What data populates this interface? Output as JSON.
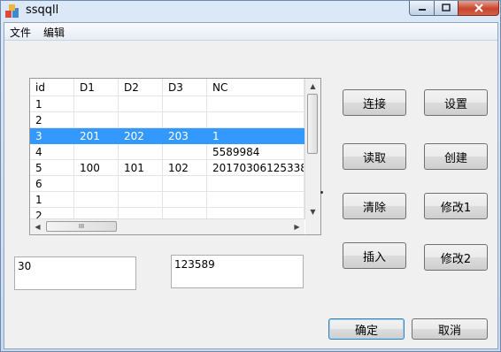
{
  "window": {
    "title": "ssqqll"
  },
  "menu": [
    "文件",
    "编辑"
  ],
  "grid": {
    "columns": [
      "id",
      "D1",
      "D2",
      "D3",
      "NC"
    ],
    "rows": [
      [
        "1",
        "",
        "",
        "",
        ""
      ],
      [
        "2",
        "",
        "",
        "",
        ""
      ],
      [
        "3",
        "201",
        "202",
        "203",
        "1"
      ],
      [
        "4",
        "",
        "",
        "",
        "5589984"
      ],
      [
        "5",
        "100",
        "101",
        "102",
        "20170306125338"
      ],
      [
        "6",
        "",
        "",
        "",
        ""
      ],
      [
        "1",
        "",
        "",
        "",
        ""
      ],
      [
        "2",
        "",
        "",
        "",
        ""
      ]
    ],
    "selected_row": 2,
    "hscroll_grip": "III"
  },
  "buttons": {
    "connect": "连接",
    "settings": "设置",
    "read": "读取",
    "create": "创建",
    "clear": "清除",
    "modify1": "修改1",
    "insert": "插入",
    "modify2": "修改2",
    "ok": "确定",
    "cancel": "取消"
  },
  "inputs": {
    "left_value": "30",
    "right_value": "123589"
  },
  "colors": {
    "selection": "#3399ff",
    "close_button": "#c7452d"
  }
}
